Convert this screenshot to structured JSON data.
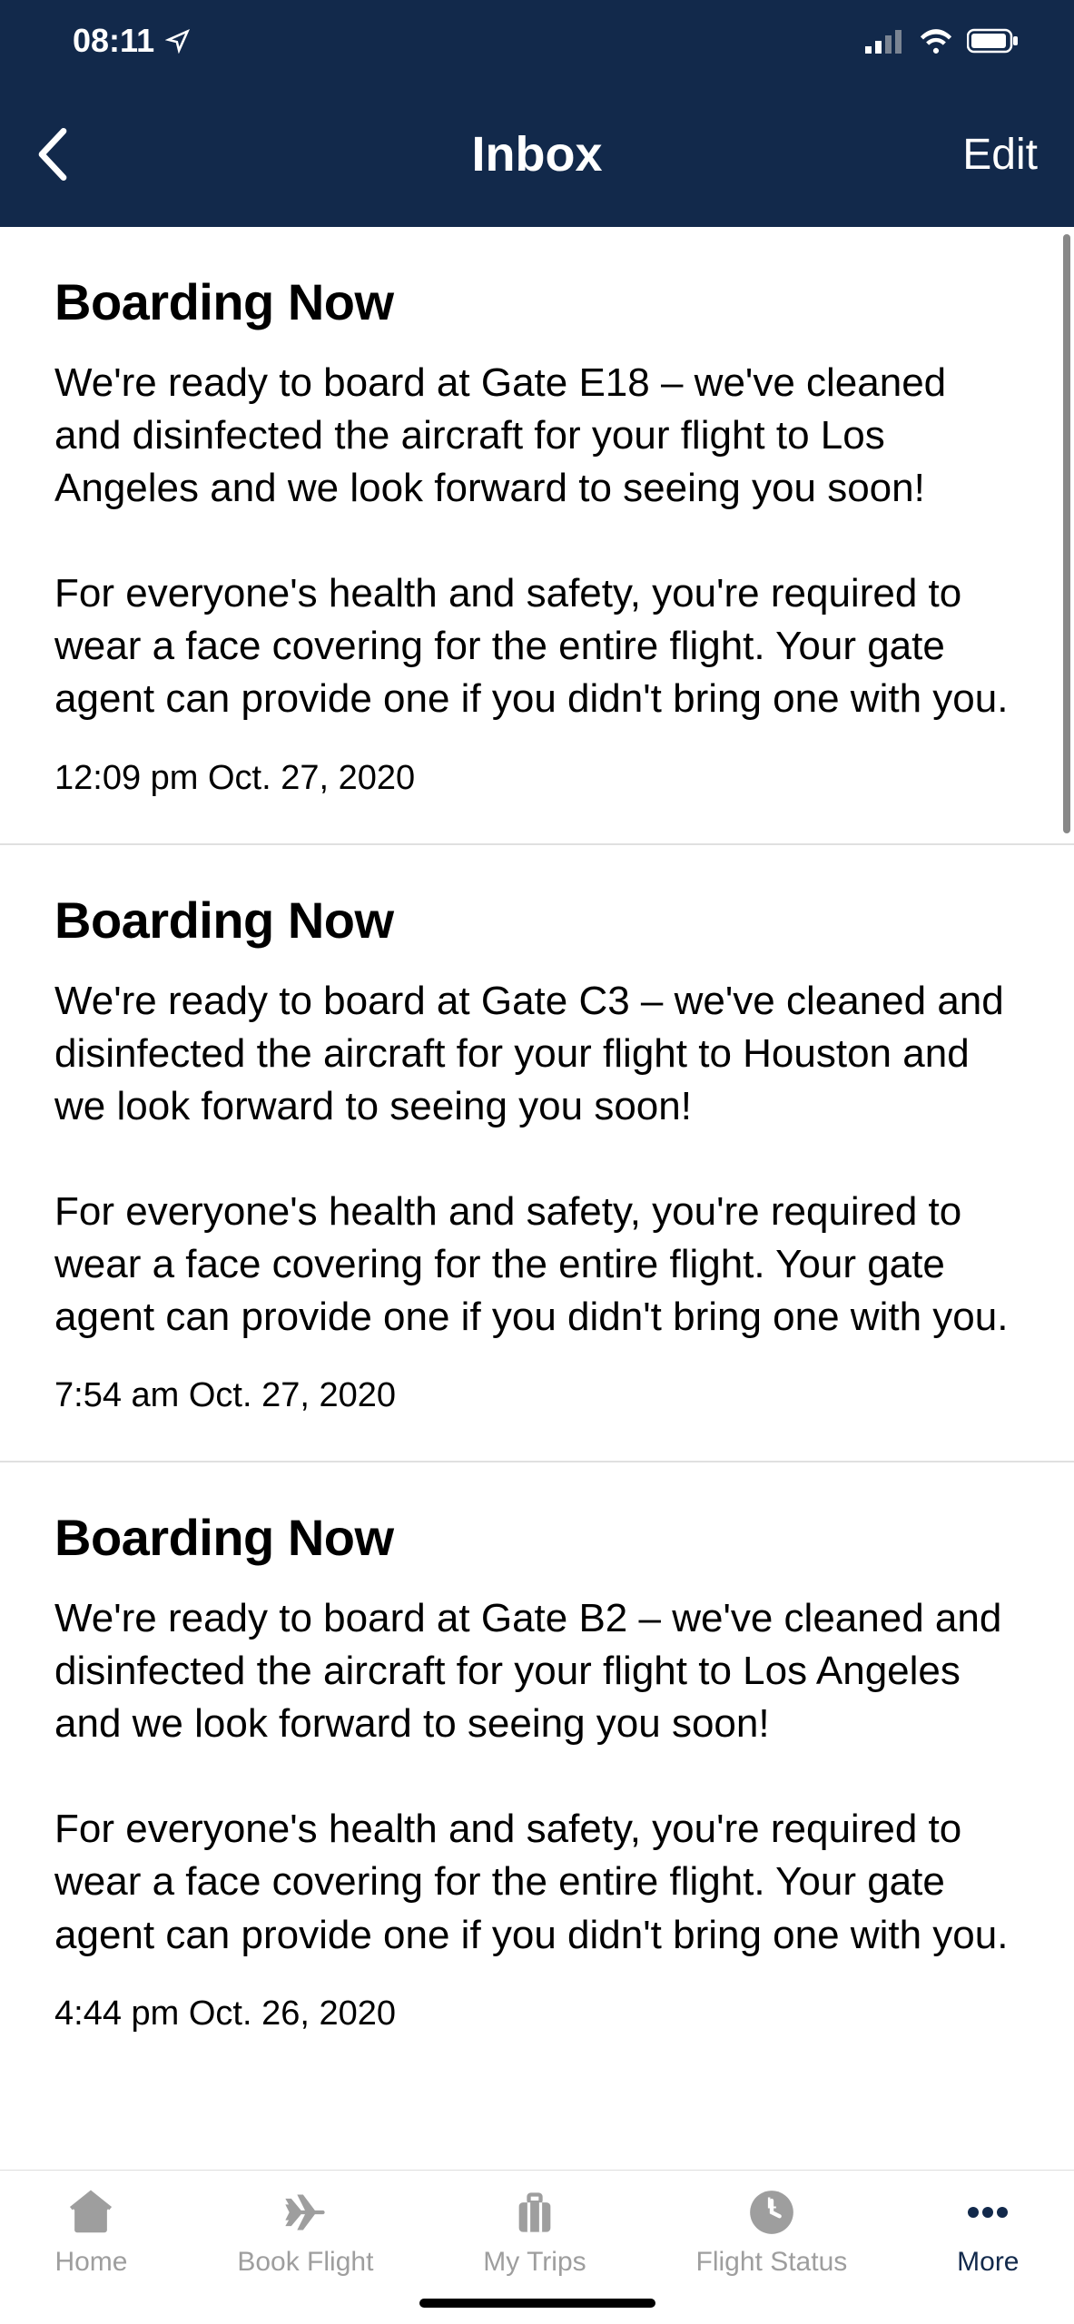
{
  "statusBar": {
    "time": "08:11"
  },
  "nav": {
    "title": "Inbox",
    "edit": "Edit"
  },
  "messages": [
    {
      "title": "Boarding Now",
      "body": "We're ready to board at Gate E18 – we've cleaned and disinfected the aircraft for your flight to Los Angeles and we look forward to seeing you soon!\n\nFor everyone's health and safety, you're required to wear a face covering for the entire flight. Your gate agent can provide one if you didn't bring one with you.",
      "time": "12:09 pm Oct. 27, 2020"
    },
    {
      "title": "Boarding Now",
      "body": "We're ready to board at Gate C3 – we've cleaned and disinfected the aircraft for your flight to Houston and we look forward to seeing you soon!\n\nFor everyone's health and safety, you're required to wear a face covering for the entire flight. Your gate agent can provide one if you didn't bring one with you.",
      "time": "7:54 am Oct. 27, 2020"
    },
    {
      "title": "Boarding Now",
      "body": "We're ready to board at Gate B2 – we've cleaned and disinfected the aircraft for your flight to Los Angeles and we look forward to seeing you soon!\n\nFor everyone's health and safety, you're required to wear a face covering for the entire flight. Your gate agent can provide one if you didn't bring one with you.",
      "time": "4:44 pm Oct. 26, 2020"
    }
  ],
  "tabs": {
    "home": "Home",
    "book": "Book Flight",
    "trips": "My Trips",
    "status": "Flight Status",
    "more": "More"
  }
}
